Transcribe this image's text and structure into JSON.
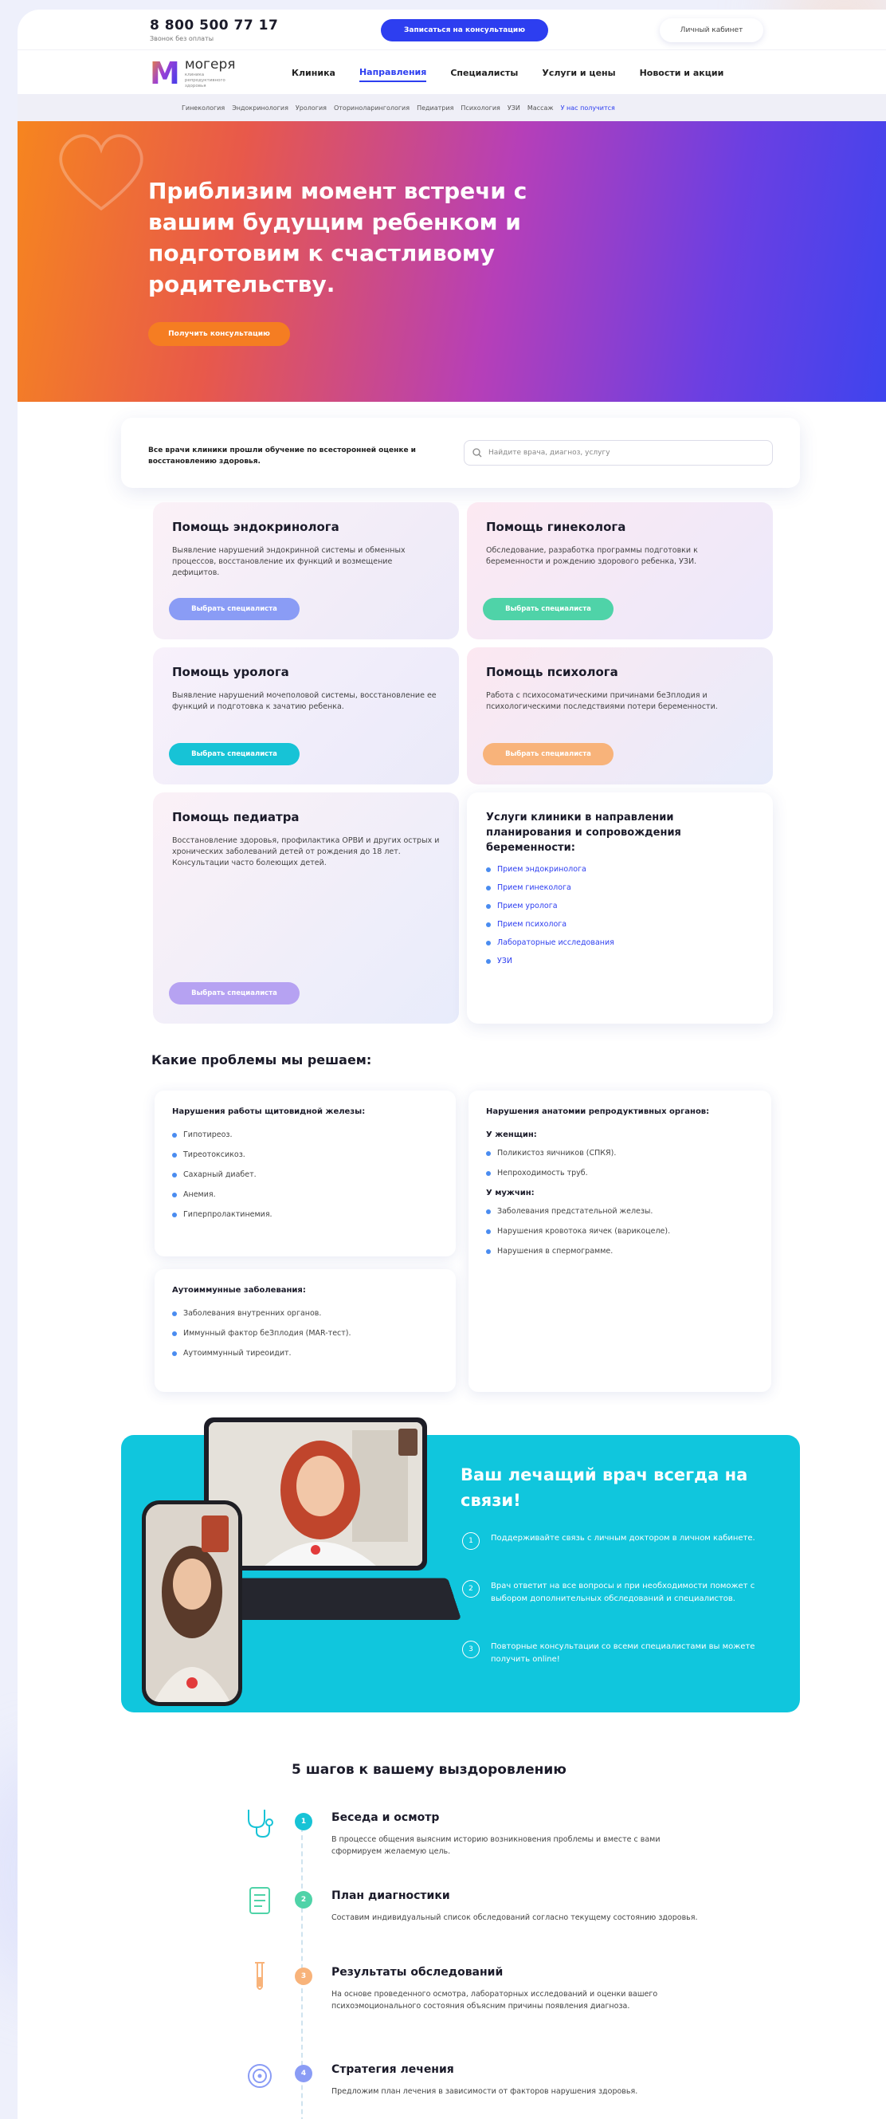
{
  "header": {
    "phone": "8 800 500 77 17",
    "phone_note": "Звонок без оплаты",
    "consult_button": "Записаться на консультацию",
    "cabinet_button": "Личный кабинет",
    "logo_letter": "M",
    "logo_name": "могеря",
    "logo_tagline": "клиника репродуктивного здоровья",
    "nav": [
      "Клиника",
      "Направления",
      "Специалисты",
      "Услуги и цены",
      "Новости и акции"
    ],
    "nav_active": "Направления",
    "subnav": [
      "Гинекология",
      "Эндокринология",
      "Урология",
      "Оториноларингология",
      "Педиатрия",
      "Психология",
      "УЗИ",
      "Массаж",
      "У нас получится"
    ]
  },
  "hero": {
    "title": "Приблизим момент встречи с вашим будущим ребенком и подготовим к счастливому родительству.",
    "button": "Получить консультацию"
  },
  "search": {
    "note": "Все врачи клиники прошли обучение по всесторонней оценке и восстановлению здоровья.",
    "placeholder": "Найдите врача, диагноз, услугу"
  },
  "help_cards": {
    "endo": {
      "title": "Помощь эндокринолога",
      "text": "Выявление нарушений эндокринной системы и обменных процессов, восстановление их функций и возмещение дефицитов.",
      "button": "Выбрать специалиста",
      "color": "#8a9cf5"
    },
    "gyn": {
      "title": "Помощь гинеколога",
      "text": "Обследование, разработка программы подготовки к беременности и рождению здорового ребенка, УЗИ.",
      "button": "Выбрать специалиста",
      "color": "#4fd3a8"
    },
    "uro": {
      "title": "Помощь уролога",
      "text": "Выявление нарушений мочеполовой системы, восстановление ее функций и подготовка к зачатию ребенка.",
      "button": "Выбрать специалиста",
      "color": "#17c3d6"
    },
    "psy": {
      "title": "Помощь психолога",
      "text": "Работа с психосоматическими причинами беЗплодия и психологическими последствиями потери беременности.",
      "button": "Выбрать специалиста",
      "color": "#f8b37a"
    },
    "ped": {
      "title": "Помощь педиатра",
      "text": "Восстановление здоровья, профилактика ОРВИ и других острых и хронических заболеваний детей от рождения до 18 лет. Консультации часто болеющих детей.",
      "button": "Выбрать специалиста",
      "color": "#b6a2f2"
    }
  },
  "services": {
    "title": "Услуги клиники в направлении планирования и сопровождения беременности:",
    "items": [
      "Прием эндокринолога",
      "Прием гинеколога",
      "Прием уролога",
      "Прием психолога",
      "Лабораторные исследования",
      "УЗИ"
    ]
  },
  "problems": {
    "title": "Какие проблемы мы решаем:",
    "thyroid": {
      "title": "Нарушения работы щитовидной железы:",
      "items": [
        "Гипотиреоз.",
        "Тиреотоксикоз.",
        "Сахарный диабет.",
        "Анемия.",
        "Гиперпролактинемия."
      ]
    },
    "autoimmune": {
      "title": "Аутоиммунные заболевания:",
      "items": [
        "Заболевания внутренних органов.",
        "Иммунный фактор беЗплодия (MAR-тест).",
        "Аутоиммунный тиреоидит."
      ]
    },
    "anatomy": {
      "title": "Нарушения анатомии репродуктивных органов:",
      "women_title": "У женщин:",
      "women": [
        "Поликистоз яичников (СПКЯ).",
        "Непроходимость труб."
      ],
      "men_title": "У мужчин:",
      "men": [
        "Заболевания предстательной железы.",
        "Нарушения кровотока яичек (варикоцеле).",
        "Нарушения в спермограмме."
      ]
    }
  },
  "doctor_banner": {
    "title": "Ваш лечащий врач всегда на связи!",
    "items": [
      {
        "num": "1",
        "text": "Поддерживайте связь с личным доктором в личном кабинете."
      },
      {
        "num": "2",
        "text": "Врач ответит на все вопросы и при необходимости поможет с выбором дополнительных обследований и специалистов."
      },
      {
        "num": "3",
        "text": "Повторные консультации со всеми специалистами вы можете получить online!"
      }
    ]
  },
  "steps": {
    "title": "5 шагов к вашему выздоровлению",
    "items": [
      {
        "num": "1",
        "title": "Беседа и осмотр",
        "text": "В процессе общения выясним историю возникновения проблемы и вместе с вами сформируем желаемую цель.",
        "color": "#17c3d6"
      },
      {
        "num": "2",
        "title": "План диагностики",
        "text": "Составим индивидуальный список обследований согласно текущему состоянию здоровья.",
        "color": "#4fd3a8"
      },
      {
        "num": "3",
        "title": "Результаты обследований",
        "text": "На основе проведенного осмотра, лабораторных исследований и оценки вашего психоэмоционального состояния объясним причины появления диагноза.",
        "color": "#f8b37a"
      },
      {
        "num": "4",
        "title": "Стратегия лечения",
        "text": "Предложим план лечения в зависимости от факторов нарушения здоровья.",
        "color": "#8a9cf5"
      }
    ]
  }
}
